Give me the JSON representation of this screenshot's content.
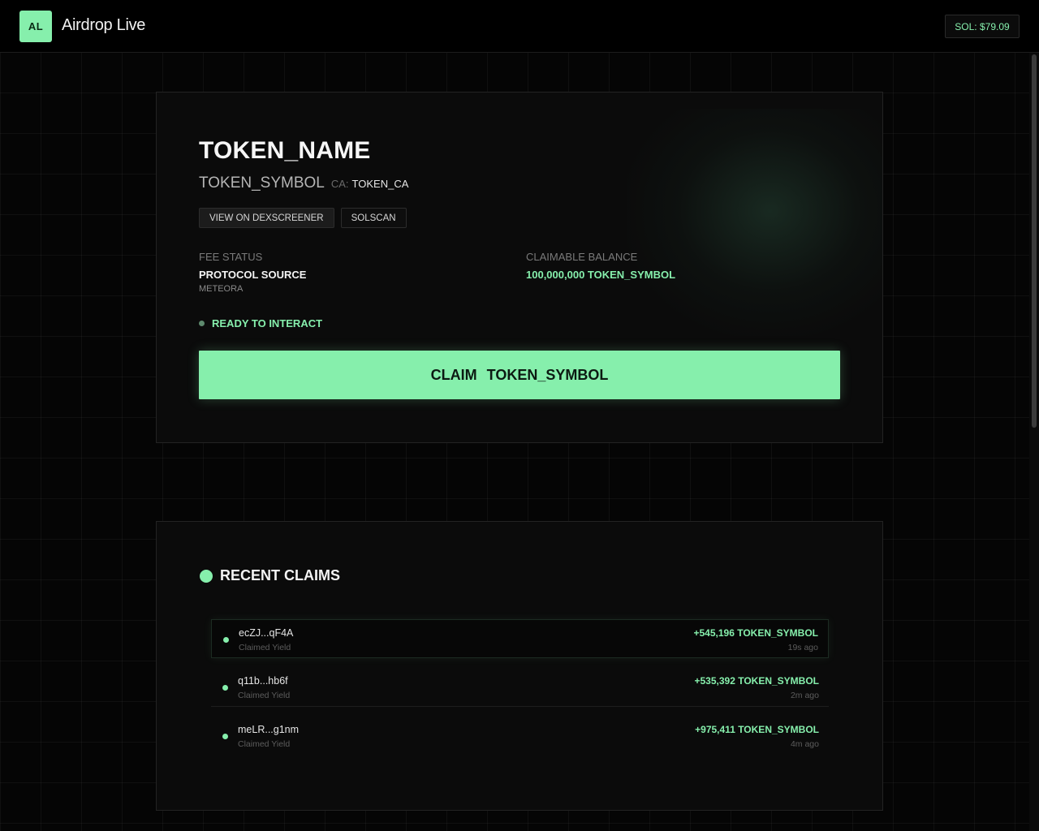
{
  "header": {
    "logo_initials": "AL",
    "title": "Airdrop Live",
    "sol_price": "SOL: $79.09"
  },
  "token": {
    "name": "TOKEN_NAME",
    "symbol": "TOKEN_SYMBOL",
    "ca_label": "CA:",
    "ca_value": "TOKEN_CA",
    "links": [
      "VIEW ON DEXSCREENER",
      "SOLSCAN"
    ],
    "fee_status_label": "FEE STATUS",
    "protocol_source_label": "PROTOCOL SOURCE",
    "protocol_source_value": "METEORA",
    "claimable_label": "CLAIMABLE BALANCE",
    "claimable_value": "100,000,000 TOKEN_SYMBOL",
    "status_text": "READY TO INTERACT",
    "claim_word": "CLAIM",
    "claim_symbol": "TOKEN_SYMBOL"
  },
  "recent_claims": {
    "title": "RECENT CLAIMS",
    "items": [
      {
        "address": "ecZJ...qF4A",
        "label": "Claimed Yield",
        "amount": "+545,196 TOKEN_SYMBOL",
        "time": "19s ago"
      },
      {
        "address": "q11b...hb6f",
        "label": "Claimed Yield",
        "amount": "+535,392 TOKEN_SYMBOL",
        "time": "2m ago"
      },
      {
        "address": "meLR...g1nm",
        "label": "Claimed Yield",
        "amount": "+975,411 TOKEN_SYMBOL",
        "time": "4m ago"
      }
    ]
  },
  "colors": {
    "accent": "#86efac",
    "background": "#050505",
    "card": "#0b0b0b"
  }
}
